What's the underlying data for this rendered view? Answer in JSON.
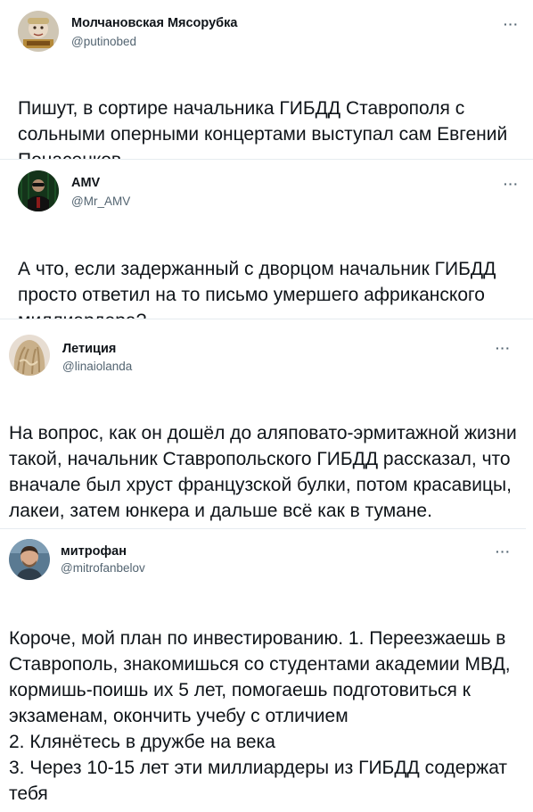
{
  "tweets": [
    {
      "name": "Молчановская Мясорубка",
      "handle": "@putinobed",
      "text": "Пишут, в сортире начальника ГИБДД Ставрополя с сольными оперными концертами выступал сам Евгений Понасенков",
      "emoji": "pointing-up-icon",
      "more": "···"
    },
    {
      "name": "AMV",
      "handle": "@Mr_AMV",
      "text": "А что, если задержанный с дворцом начальник ГИБДД просто ответил на то письмо умершего африканского миллиардера?",
      "emoji": "thinking-face-icon",
      "more": "···"
    },
    {
      "name": "Летиция",
      "handle": "@linaiolanda",
      "text": "На вопрос, как он дошёл до аляповато-эрмитажной жизни такой, начальник Ставропольского ГИБДД рассказал, что вначале был хруст французской булки, потом красавицы, лакеи, затем юнкера и дальше всё как в тумане.",
      "more": "···"
    },
    {
      "name": "митрофан",
      "handle": "@mitrofanbelov",
      "text": "Короче, мой план по инвестированию. 1. Переезжаешь в Ставрополь, знакомишься со студентами академии МВД, кормишь-поишь их 5 лет, помогаешь подготовиться к экзаменам, окончить учебу с отличием\n2. Клянётесь в дружбе на века\n3. Через 10-15 лет эти миллиардеры из ГИБДД содержат тебя",
      "more": "···"
    }
  ]
}
